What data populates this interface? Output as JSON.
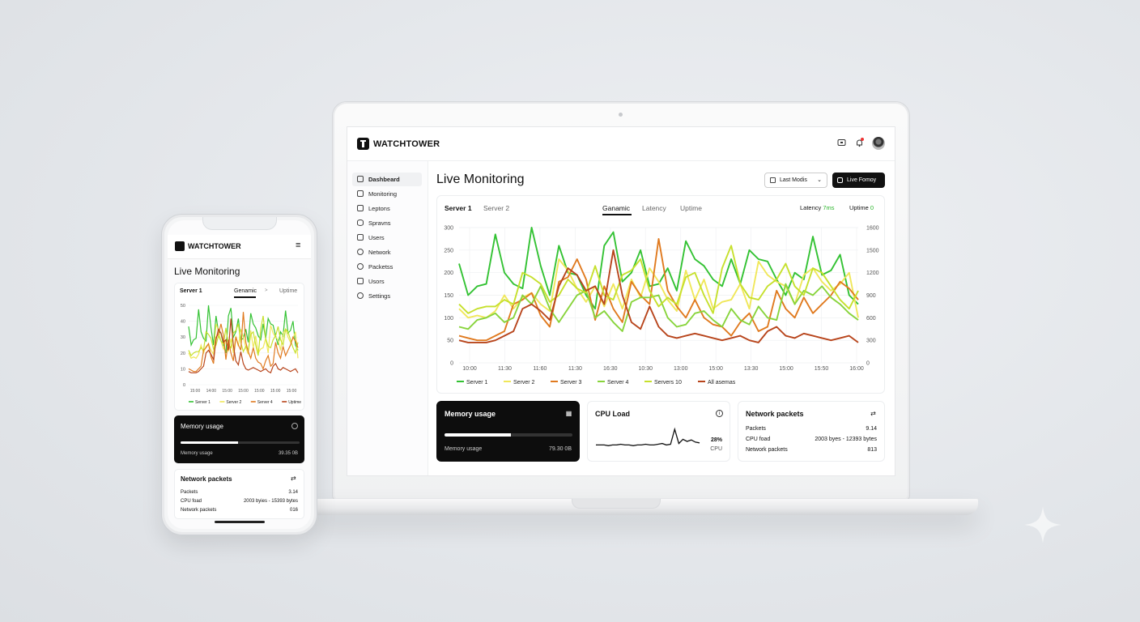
{
  "app": {
    "brand": "WATCHTOWER",
    "page_title": "Live Monitoring"
  },
  "colors": {
    "server1": "#33c233",
    "server2": "#f0e75a",
    "server3": "#e07a1f",
    "server4": "#88d43c",
    "servers10": "#c6e02d",
    "all": "#b8451c",
    "accent_green": "#2bb52b"
  },
  "sidebar": {
    "items": [
      {
        "label": "Dashbeard",
        "icon": "home-icon"
      },
      {
        "label": "Monitoring",
        "icon": "grid-icon"
      },
      {
        "label": "Leptons",
        "icon": "list-icon"
      },
      {
        "label": "Spravns",
        "icon": "database-icon"
      },
      {
        "label": "Users",
        "icon": "monitor-icon"
      },
      {
        "label": "Network",
        "icon": "network-icon"
      },
      {
        "label": "Packetss",
        "icon": "globe-icon"
      },
      {
        "label": "Usors",
        "icon": "lock-icon"
      },
      {
        "label": "Settings",
        "icon": "gear-icon"
      }
    ]
  },
  "toolbar": {
    "range_label": "Last Modis",
    "live_label": "Live Fomoy"
  },
  "chart_card": {
    "server_tabs": [
      "Server 1",
      "Server 2"
    ],
    "metric_tabs": [
      "Ganamic",
      "Latency",
      "Uptime"
    ],
    "latency_label": "Latency",
    "latency_value": "7ms",
    "uptime_label": "Uptime",
    "uptime_value": "0"
  },
  "chart_data": {
    "type": "line",
    "x": [
      "10:00",
      "11:30",
      "11:60",
      "11:30",
      "16:30",
      "10:30",
      "13:00",
      "15:00",
      "13:30",
      "15:00",
      "15:50",
      "16:00"
    ],
    "y_left_ticks": [
      "300",
      "250",
      "200",
      "150",
      "100",
      "50",
      "0"
    ],
    "y_right_ticks": [
      "1600",
      "1500",
      "1200",
      "900",
      "600",
      "300",
      "0"
    ],
    "ylim": [
      0,
      300
    ],
    "series": [
      {
        "name": "Server 1",
        "values": [
          220,
          150,
          170,
          175,
          285,
          200,
          175,
          165,
          300,
          215,
          150,
          260,
          200,
          195,
          150,
          120,
          260,
          290,
          180,
          200,
          250,
          170,
          175,
          210,
          160,
          270,
          230,
          215,
          185,
          170,
          230,
          175,
          250,
          230,
          225,
          185,
          150,
          200,
          185,
          280,
          195,
          205,
          240,
          150,
          130
        ]
      },
      {
        "name": "Server 2",
        "values": [
          120,
          100,
          105,
          100,
          115,
          150,
          120,
          145,
          155,
          130,
          115,
          230,
          205,
          165,
          135,
          170,
          125,
          175,
          120,
          185,
          145,
          210,
          180,
          140,
          115,
          205,
          140,
          185,
          120,
          135,
          140,
          175,
          120,
          225,
          195,
          180,
          170,
          130,
          195,
          210,
          180,
          160,
          175,
          200,
          100
        ]
      },
      {
        "name": "Server 3",
        "values": [
          60,
          55,
          50,
          50,
          60,
          70,
          130,
          140,
          155,
          105,
          80,
          180,
          190,
          230,
          185,
          95,
          170,
          120,
          90,
          180,
          150,
          130,
          275,
          160,
          125,
          100,
          140,
          100,
          85,
          80,
          60,
          90,
          110,
          70,
          80,
          160,
          120,
          100,
          145,
          110,
          130,
          150,
          180,
          165,
          140
        ]
      },
      {
        "name": "Server 4",
        "values": [
          80,
          75,
          95,
          100,
          110,
          90,
          100,
          150,
          130,
          170,
          120,
          90,
          120,
          150,
          160,
          100,
          115,
          90,
          70,
          135,
          145,
          145,
          150,
          100,
          80,
          85,
          110,
          115,
          95,
          80,
          120,
          95,
          85,
          125,
          100,
          95,
          175,
          130,
          160,
          150,
          170,
          145,
          130,
          110,
          95
        ]
      },
      {
        "name": "Servers 10",
        "values": [
          130,
          110,
          120,
          125,
          125,
          140,
          130,
          200,
          190,
          175,
          135,
          150,
          185,
          165,
          155,
          215,
          150,
          140,
          195,
          205,
          230,
          160,
          125,
          145,
          130,
          190,
          200,
          150,
          110,
          210,
          260,
          175,
          145,
          140,
          170,
          185,
          220,
          170,
          150,
          210,
          200,
          170,
          140,
          120,
          160
        ]
      },
      {
        "name": "All asemas",
        "values": [
          50,
          45,
          45,
          45,
          50,
          60,
          70,
          120,
          130,
          115,
          95,
          170,
          210,
          195,
          160,
          170,
          130,
          250,
          150,
          90,
          75,
          125,
          80,
          60,
          55,
          60,
          65,
          60,
          55,
          50,
          55,
          60,
          50,
          45,
          70,
          80,
          60,
          55,
          65,
          60,
          55,
          50,
          55,
          60,
          45
        ]
      }
    ]
  },
  "memory": {
    "title": "Memory usage",
    "label": "Memory usage",
    "value": "79.30 0B",
    "fill_percent": 52
  },
  "cpu": {
    "title": "CPU Load",
    "percent": "28%",
    "unit": "CPU",
    "spark": [
      12,
      12,
      12,
      11,
      12,
      12,
      13,
      12,
      12,
      11,
      12,
      12,
      13,
      12,
      12,
      13,
      14,
      12,
      13,
      34,
      14,
      20,
      17,
      19,
      16,
      15
    ]
  },
  "network": {
    "title": "Network packets",
    "rows": [
      {
        "label": "Packets",
        "value": "9.14"
      },
      {
        "label": "CPU foad",
        "value": "2003 byes - 12393 bytes"
      },
      {
        "label": "Network packets",
        "value": "813"
      }
    ]
  },
  "phone": {
    "brand": "WATCHTOWER",
    "page_title": "Live Monitoring",
    "server_tab": "Server 1",
    "metric_tabs": [
      "Genamic",
      ">",
      "Uptime"
    ],
    "y_ticks": [
      "50",
      "40",
      "30",
      "20",
      "10",
      "0"
    ],
    "x_ticks": [
      "15:00",
      "14:00",
      "15:00",
      "15:00",
      "15:00",
      "15:00",
      "15:00"
    ],
    "legend": [
      "Server 1",
      "Server 2",
      "Server 4",
      "Uptime"
    ],
    "memory_title": "Memory usage",
    "memory_label": "Memory usage",
    "memory_value": "39.35 0B",
    "memory_fill_percent": 48,
    "network_title": "Network packets",
    "network_rows": [
      {
        "label": "Packets",
        "value": "3.14"
      },
      {
        "label": "CPU foad",
        "value": "2003 byies - 15393 bytes"
      },
      {
        "label": "Network packets",
        "value": "016"
      }
    ]
  }
}
